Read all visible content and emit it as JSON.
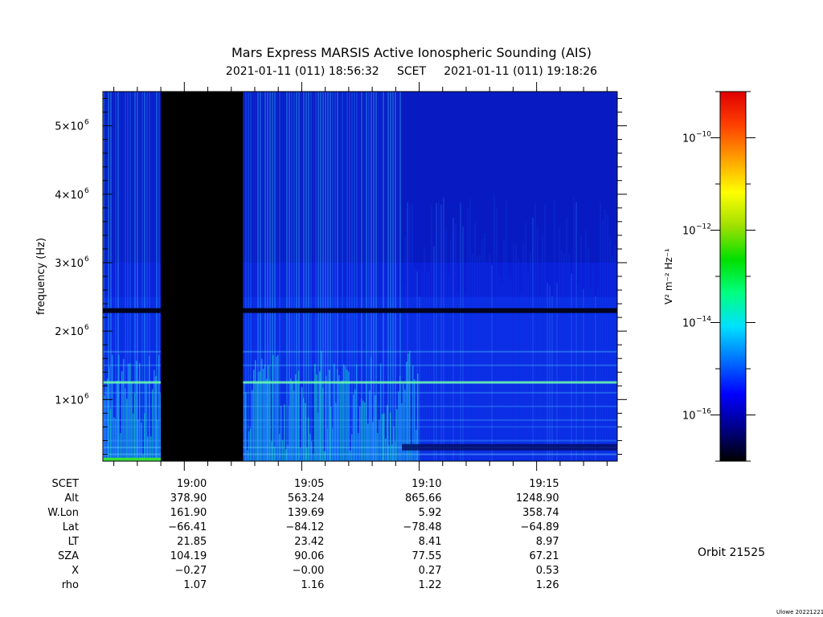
{
  "title": "Mars Express MARSIS Active Ionospheric Sounding (AIS)",
  "subtitle": "2021-01-11 (011) 18:56:32     SCET     2021-01-11 (011) 19:18:26",
  "chart_data": {
    "type": "heatmap",
    "ylabel": "frequency (Hz)",
    "x_range_scet": [
      "18:56:32",
      "19:18:26"
    ],
    "ylim": [
      100000,
      5500000
    ],
    "y_ticks": [
      {
        "value": 1000000,
        "mant": "1×10",
        "exp": "6"
      },
      {
        "value": 2000000,
        "mant": "2×10",
        "exp": "6"
      },
      {
        "value": 3000000,
        "mant": "3×10",
        "exp": "6"
      },
      {
        "value": 4000000,
        "mant": "4×10",
        "exp": "6"
      },
      {
        "value": 5000000,
        "mant": "5×10",
        "exp": "6"
      }
    ],
    "x_ticks": [
      "19:00",
      "19:05",
      "19:10",
      "19:15"
    ],
    "data_gap": {
      "start": "18:59",
      "end": "19:02:30"
    },
    "dark_band_hz": 2300000,
    "bright_line_hz": 1250000,
    "colorbar": {
      "label": "V² m⁻² Hz⁻¹",
      "scale": "log",
      "range_exp": [
        -17,
        -9
      ],
      "ticks": [
        {
          "mant": "10",
          "exp": "−10"
        },
        {
          "mant": "10",
          "exp": "−12"
        },
        {
          "mant": "10",
          "exp": "−14"
        },
        {
          "mant": "10",
          "exp": "−16"
        }
      ],
      "colors": [
        "#000000",
        "#00008b",
        "#0000ff",
        "#0070ff",
        "#00e0ff",
        "#00ff80",
        "#00e000",
        "#a0e000",
        "#ffff00",
        "#ffa000",
        "#ff4000",
        "#e00000"
      ]
    }
  },
  "ephemeris": {
    "labels": [
      "SCET",
      "Alt",
      "W.Lon",
      "Lat",
      "LT",
      "SZA",
      "X",
      "rho"
    ],
    "columns": [
      {
        "scet": "19:00",
        "values": [
          "378.90",
          "161.90",
          "−66.41",
          "21.85",
          "104.19",
          "−0.27",
          "1.07"
        ]
      },
      {
        "scet": "19:05",
        "values": [
          "563.24",
          "139.69",
          "−84.12",
          "23.42",
          "90.06",
          "−0.00",
          "1.16"
        ]
      },
      {
        "scet": "19:10",
        "values": [
          "865.66",
          "5.92",
          "−78.48",
          "8.41",
          "77.55",
          "0.27",
          "1.22"
        ]
      },
      {
        "scet": "19:15",
        "values": [
          "1248.90",
          "358.74",
          "−64.89",
          "8.97",
          "67.21",
          "0.53",
          "1.26"
        ]
      }
    ]
  },
  "orbit": "Orbit 21525",
  "version": "Ulowe 20221221"
}
